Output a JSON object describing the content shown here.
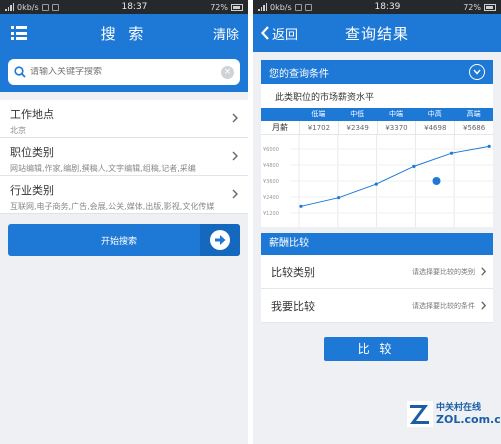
{
  "left": {
    "status": {
      "network": "0kb/s",
      "time": "18:37",
      "battery": "72%"
    },
    "title": "搜 索",
    "clear_label": "清除",
    "search": {
      "placeholder": "请输入关键字搜索",
      "value": ""
    },
    "fields": [
      {
        "label": "工作地点",
        "value": "北京"
      },
      {
        "label": "职位类别",
        "value": "网站编辑,作家,编剧,撰稿人,文字编辑,组稿,记者,采编"
      },
      {
        "label": "行业类别",
        "value": "互联网,电子商务,广告,会展,公关,媒体,出版,影视,文化传媒"
      }
    ],
    "start_button": "开始搜索"
  },
  "right": {
    "status": {
      "network": "0kb/s",
      "time": "18:39",
      "battery": "72%"
    },
    "back_label": "返回",
    "title": "查询结果",
    "condition_label": "您的查询条件",
    "subtitle": "此类职位的市场薪资水平",
    "salary_table": {
      "headers": [
        "",
        "低端",
        "中低",
        "中端",
        "中高",
        "高端"
      ],
      "row_label": "月薪",
      "values": [
        "¥1702",
        "¥2349",
        "¥3370",
        "¥4698",
        "¥5686"
      ]
    },
    "compare_header": "薪酬比较",
    "compare_rows": [
      {
        "label": "比较类别",
        "hint": "请选择要比较的类别"
      },
      {
        "label": "我要比较",
        "hint": "请选择要比较的条件"
      }
    ],
    "compare_button": "比 较"
  },
  "chart_data": {
    "type": "line",
    "categories": [
      "低端",
      "中低",
      "中端",
      "中高",
      "高端"
    ],
    "x": [
      0,
      1,
      2,
      3,
      4,
      5
    ],
    "values": [
      1702,
      2349,
      3370,
      4698,
      5686,
      6200
    ],
    "highlight": {
      "x": 3.6,
      "value": 3600
    },
    "yticks": [
      "¥6000",
      "¥4800",
      "¥3600",
      "¥2400",
      "¥1200"
    ],
    "ytick_values": [
      6000,
      4800,
      3600,
      2400,
      1200
    ],
    "ylim": [
      600,
      6600
    ],
    "color": "#1e79d6",
    "grid": true
  },
  "watermark": {
    "line1": "中关村在线",
    "line2": "ZOL.com.cn"
  },
  "colors": {
    "primary": "#1e79d6",
    "statusbar": "#26292c",
    "background": "#eef0f3"
  }
}
